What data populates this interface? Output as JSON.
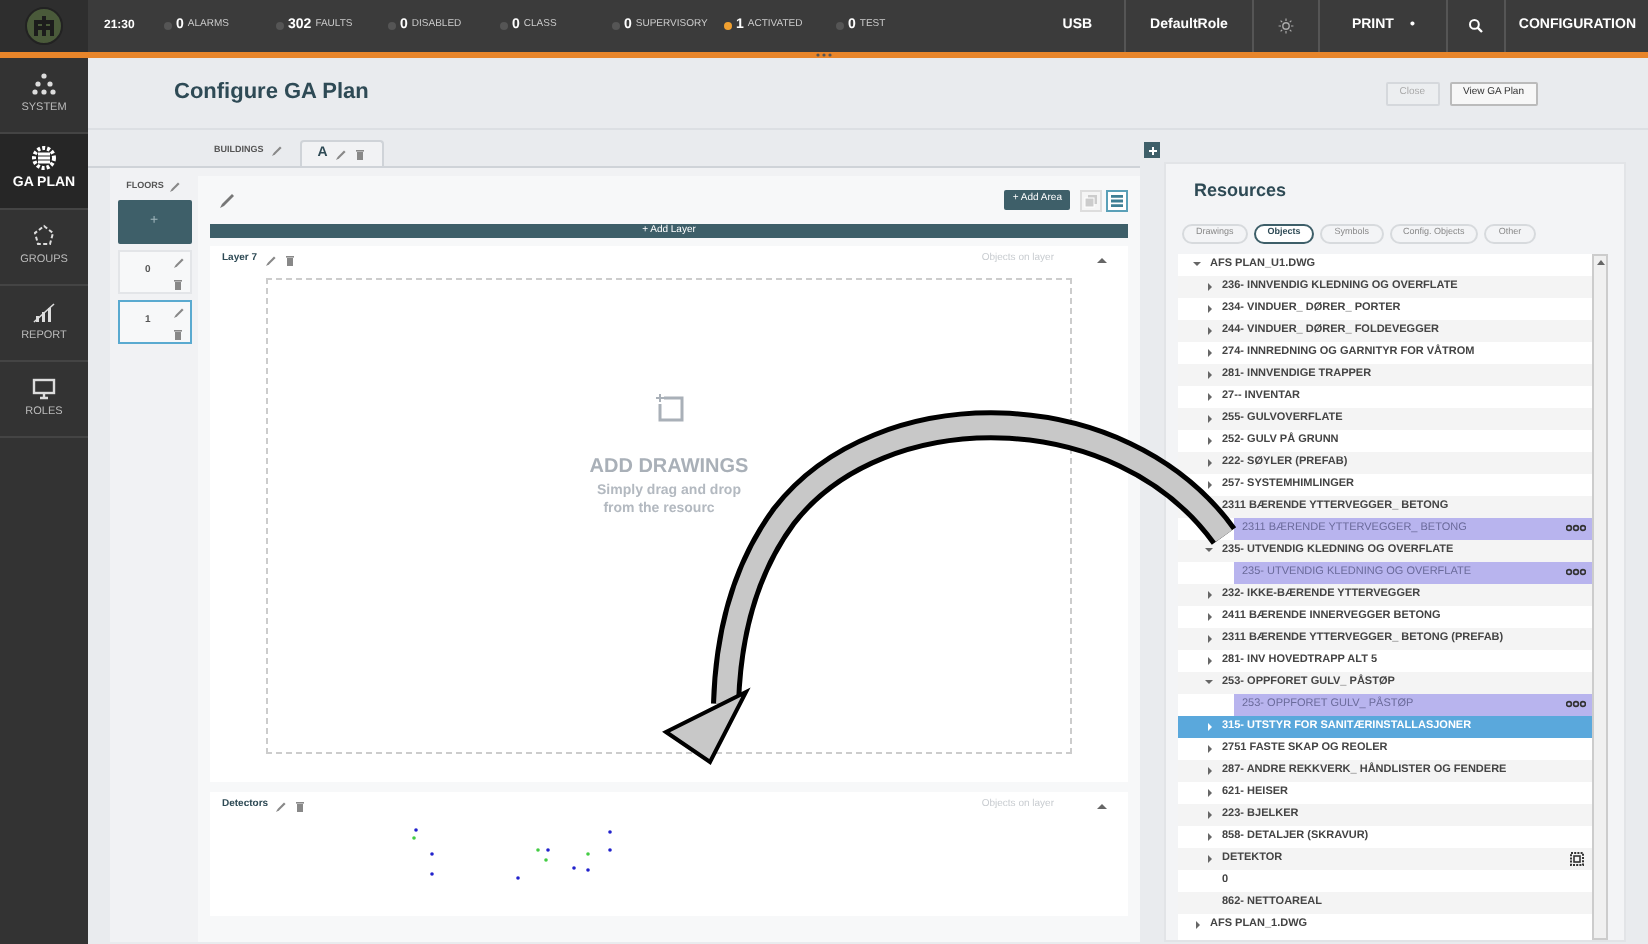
{
  "top_bar": {
    "time": "21:30",
    "counters": [
      {
        "count": "0",
        "label": "ALARMS",
        "color": "#555555"
      },
      {
        "count": "302",
        "label": "FAULTS",
        "color": "#555555"
      },
      {
        "count": "0",
        "label": "DISABLED",
        "color": "#555555"
      },
      {
        "count": "0",
        "label": "CLASS",
        "color": "#555555"
      },
      {
        "count": "0",
        "label": "SUPERVISORY",
        "color": "#555555"
      },
      {
        "count": "1",
        "label": "ACTIVATED",
        "color": "#f0a030"
      },
      {
        "count": "0",
        "label": "TEST",
        "color": "#555555"
      }
    ],
    "usb": "USB",
    "role": "DefaultRole",
    "print": "PRINT",
    "print_dot": "•",
    "configuration": "CONFIGURATION"
  },
  "sidebar": {
    "items": [
      {
        "label": "SYSTEM",
        "kind": "system",
        "selected": false
      },
      {
        "label": "GA PLAN",
        "kind": "plan",
        "selected": true
      },
      {
        "label": "GROUPS",
        "kind": "groups",
        "selected": false
      },
      {
        "label": "REPORT",
        "kind": "report",
        "selected": false
      },
      {
        "label": "ROLES",
        "kind": "roles",
        "selected": false
      }
    ]
  },
  "header": {
    "title": "Configure GA Plan",
    "buttons": [
      {
        "label": "Close",
        "disabled": true
      },
      {
        "label": "View GA Plan",
        "disabled": false
      }
    ]
  },
  "buildings": {
    "label": "BUILDINGS",
    "tabs": [
      {
        "label": "A",
        "selected": true
      }
    ]
  },
  "floors": {
    "label": "FLOORS",
    "add": "+",
    "items": [
      {
        "label": "0",
        "selected": false
      },
      {
        "label": "1",
        "selected": true
      }
    ]
  },
  "toolbar": {
    "add_area": "+ Add Area",
    "views": [
      {
        "kind": "stack",
        "selected": false
      },
      {
        "kind": "list",
        "selected": true
      }
    ],
    "add_layer": "+ Add Layer"
  },
  "layers": [
    {
      "name": "Layer 7",
      "objects": "Objects on layer",
      "kind": "drop",
      "drop_title": "ADD DRAWINGS",
      "drop_text": "Simply drag and drop",
      "drop_text_2": "from the resourc"
    },
    {
      "name": "Detectors",
      "objects": "Objects on layer",
      "kind": "detectors"
    }
  ],
  "resources": {
    "title": "Resources",
    "tabs": [
      {
        "label": "Drawings",
        "selected": false
      },
      {
        "label": "Objects",
        "selected": true
      },
      {
        "label": "Symbols",
        "selected": false
      },
      {
        "label": "Config. Objects",
        "selected": false
      },
      {
        "label": "Other",
        "selected": false
      }
    ],
    "tree": [
      {
        "label": "AFS PLAN_U1.DWG",
        "kind": "folder",
        "expanded": true,
        "selected": false,
        "children": [
          {
            "label": "236- INNVENDIG KLEDNING OG OVERFLATE",
            "kind": "folder",
            "expanded": false,
            "selected": false
          },
          {
            "label": "234- VINDUER_ DØRER_ PORTER",
            "kind": "folder",
            "expanded": false,
            "selected": false
          },
          {
            "label": "244- VINDUER_ DØRER_ FOLDEVEGGER",
            "kind": "folder",
            "expanded": false,
            "selected": false
          },
          {
            "label": "274- INNREDNING OG GARNITYR FOR VÅTROM",
            "kind": "folder",
            "expanded": false,
            "selected": false
          },
          {
            "label": "281- INNVENDIGE TRAPPER",
            "kind": "folder",
            "expanded": false,
            "selected": false
          },
          {
            "label": "27-- INVENTAR",
            "kind": "folder",
            "expanded": false,
            "selected": false
          },
          {
            "label": "255- GULVOVERFLATE",
            "kind": "folder",
            "expanded": false,
            "selected": false
          },
          {
            "label": "252- GULV PÅ GRUNN",
            "kind": "folder",
            "expanded": false,
            "selected": false
          },
          {
            "label": "222- SØYLER (PREFAB)",
            "kind": "folder",
            "expanded": false,
            "selected": false
          },
          {
            "label": "257- SYSTEMHIMLINGER",
            "kind": "folder",
            "expanded": false,
            "selected": false
          },
          {
            "label": "2311 BÆRENDE YTTERVEGGER_ BETONG",
            "kind": "leaf",
            "selected": false,
            "children": [
              {
                "label": "2311 BÆRENDE YTTERVEGGER_ BETONG",
                "kind": "object",
                "selected": false
              }
            ]
          },
          {
            "label": "235- UTVENDIG KLEDNING OG OVERFLATE",
            "kind": "folder",
            "expanded": true,
            "selected": false,
            "children": [
              {
                "label": "235- UTVENDIG KLEDNING OG OVERFLATE",
                "kind": "object",
                "selected": false
              }
            ]
          },
          {
            "label": "232- IKKE-BÆRENDE YTTERVEGGER",
            "kind": "folder",
            "expanded": false,
            "selected": false
          },
          {
            "label": "2411 BÆRENDE INNERVEGGER BETONG",
            "kind": "folder",
            "expanded": false,
            "selected": false
          },
          {
            "label": "2311 BÆRENDE YTTERVEGGER_ BETONG (PREFAB)",
            "kind": "folder",
            "expanded": false,
            "selected": false
          },
          {
            "label": "281- INV HOVEDTRAPP ALT 5",
            "kind": "folder",
            "expanded": false,
            "selected": false
          },
          {
            "label": "253- OPPFORET GULV_ PÅSTØP",
            "kind": "folder",
            "expanded": true,
            "selected": false,
            "children": [
              {
                "label": "253- OPPFORET GULV_ PÅSTØP",
                "kind": "object",
                "selected": false
              }
            ]
          },
          {
            "label": "315- UTSTYR FOR SANITÆRINSTALLASJONER",
            "kind": "folder",
            "expanded": false,
            "selected": true
          },
          {
            "label": "2751 FASTE SKAP OG REOLER",
            "kind": "folder",
            "expanded": false,
            "selected": false
          },
          {
            "label": "287- ANDRE REKKVERK_ HÅNDLISTER OG FENDERE",
            "kind": "folder",
            "expanded": false,
            "selected": false
          },
          {
            "label": "621- HEISER",
            "kind": "folder",
            "expanded": false,
            "selected": false
          },
          {
            "label": "223- BJELKER",
            "kind": "folder",
            "expanded": false,
            "selected": false
          },
          {
            "label": "858- DETALJER (SKRAVUR)",
            "kind": "folder",
            "expanded": false,
            "selected": false
          },
          {
            "label": "DETEKTOR",
            "kind": "detector",
            "expanded": false,
            "selected": false
          },
          {
            "label": "0",
            "kind": "leaf",
            "selected": false
          },
          {
            "label": "862- NETTOAREAL",
            "kind": "leaf",
            "selected": false
          }
        ]
      },
      {
        "label": "AFS PLAN_1.DWG",
        "kind": "folder",
        "expanded": false,
        "selected": false
      }
    ]
  }
}
